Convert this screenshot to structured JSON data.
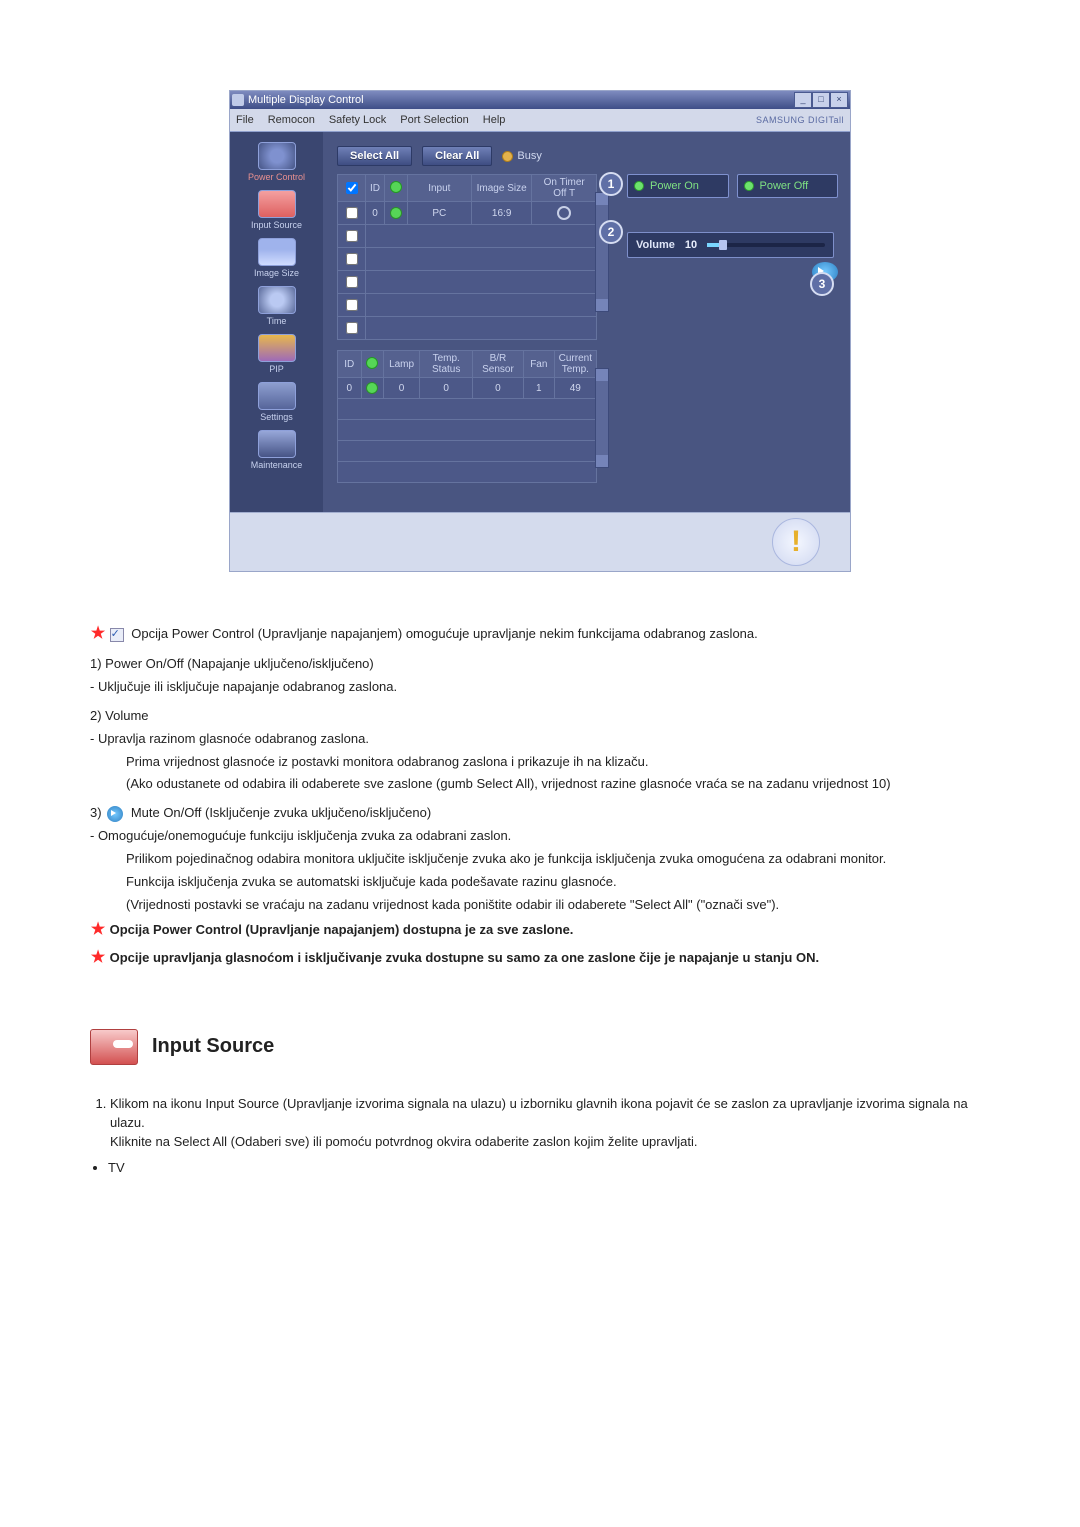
{
  "app": {
    "title": "Multiple Display Control",
    "brand": "SAMSUNG DIGITall",
    "menu": [
      "File",
      "Remocon",
      "Safety Lock",
      "Port Selection",
      "Help"
    ],
    "window_buttons": [
      "_",
      "□",
      "×"
    ]
  },
  "sidebar": {
    "items": [
      {
        "label": "Power Control",
        "active": true
      },
      {
        "label": "Input Source"
      },
      {
        "label": "Image Size"
      },
      {
        "label": "Time"
      },
      {
        "label": "PIP"
      },
      {
        "label": "Settings"
      },
      {
        "label": "Maintenance"
      }
    ]
  },
  "controls": {
    "select_all": "Select All",
    "clear_all": "Clear All",
    "busy_label": "Busy"
  },
  "top_table": {
    "headers": [
      "",
      "ID",
      "",
      "Input",
      "Image Size",
      "On Timer Off T"
    ],
    "rows": [
      {
        "checked": true,
        "id": "0",
        "status": "green",
        "input": "PC",
        "image_size": "16:9",
        "onoff": "ring"
      }
    ],
    "empty_rows": 5
  },
  "bottom_table": {
    "headers": [
      "ID",
      "",
      "Lamp",
      "Temp. Status",
      "B/R Sensor",
      "Fan",
      "Current Temp."
    ],
    "rows": [
      {
        "id": "0",
        "status": "green",
        "lamp": "0",
        "temp_status": "0",
        "br": "0",
        "fan": "1",
        "cur_temp": "49"
      }
    ],
    "empty_rows": 4
  },
  "right_pane": {
    "power_on": "Power On",
    "power_off": "Power Off",
    "volume_label": "Volume",
    "volume_value": "10",
    "callouts": {
      "c1": "1",
      "c2": "2",
      "c3": "3"
    }
  },
  "info_icon": "!",
  "doc": {
    "star_line": "Opcija Power Control (Upravljanje napajanjem) omogućuje upravljanje nekim funkcijama odabranog zaslona.",
    "item1_head": "1)  Power On/Off (Napajanje uključeno/isključeno)",
    "item1_sub": "- Uključuje ili isključuje napajanje odabranog zaslona.",
    "item2_head": "2)  Volume",
    "item2_sub1": "- Upravlja razinom glasnoće odabranog zaslona.",
    "item2_sub2": "Prima vrijednost glasnoće iz postavki monitora odabranog zaslona i prikazuje ih na klizaču.",
    "item2_sub3": "(Ako odustanete od odabira ili odaberete sve zaslone (gumb Select All), vrijednost razine glasnoće vraća se na zadanu vrijednost 10)",
    "item3_head_prefix": "3)",
    "item3_head_text": " Mute On/Off (Isključenje zvuka uključeno/isključeno)",
    "item3_sub1": "- Omogućuje/onemogućuje funkciju isključenja zvuka za odabrani zaslon.",
    "item3_sub2": "Prilikom pojedinačnog odabira monitora uključite isključenje zvuka ako je funkcija isključenja zvuka omogućena za odabrani monitor.",
    "item3_sub3": "Funkcija isključenja zvuka se automatski isključuje kada podešavate razinu glasnoće.",
    "item3_sub4": "(Vrijednosti postavki se vraćaju na zadanu vrijednost kada poništite odabir ili odaberete \"Select All\" (\"označi sve\").",
    "note1": "Opcija Power Control (Upravljanje napajanjem) dostupna je za sve zaslone.",
    "note2": "Opcije upravljanja glasnoćom i isključivanje zvuka dostupne su samo za one zaslone čije je napajanje u stanju ON.",
    "section_title": "Input Source",
    "ol_item1a": "Klikom na ikonu Input Source (Upravljanje izvorima signala na ulazu) u izborniku glavnih ikona pojavit će se zaslon za upravljanje izvorima signala na ulazu.",
    "ol_item1b": "Kliknite na Select All (Odaberi sve) ili pomoću potvrdnog okvira odaberite zaslon kojim želite upravljati.",
    "bullet_tv": "TV"
  }
}
